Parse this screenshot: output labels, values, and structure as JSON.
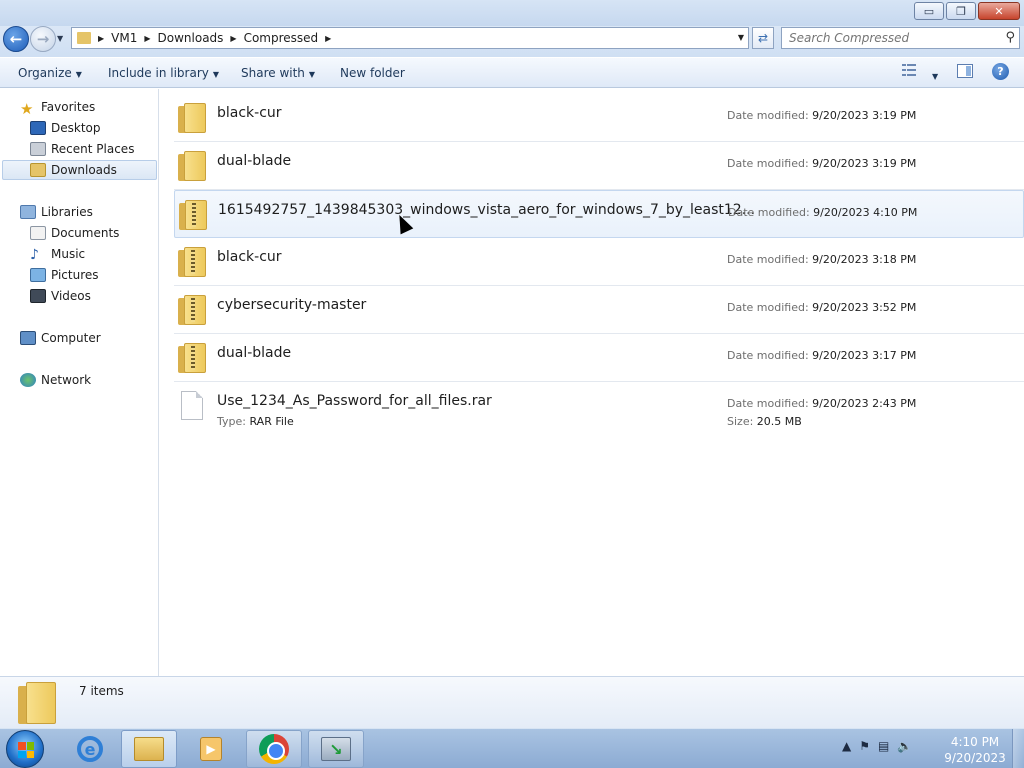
{
  "window": {
    "minimize_glyph": "▭",
    "restore_glyph": "❐",
    "close_glyph": "✕"
  },
  "address_bar": {
    "breadcrumbs": [
      "VM1",
      "Downloads",
      "Compressed"
    ],
    "search_placeholder": "Search Compressed"
  },
  "toolbar": {
    "organize": "Organize",
    "include_in_library": "Include in library",
    "share_with": "Share with",
    "new_folder": "New folder",
    "help": "?"
  },
  "sidebar": {
    "favorites": {
      "label": "Favorites",
      "items": [
        "Desktop",
        "Recent Places",
        "Downloads"
      ]
    },
    "libraries": {
      "label": "Libraries",
      "items": [
        "Documents",
        "Music",
        "Pictures",
        "Videos"
      ]
    },
    "computer": "Computer",
    "network": "Network"
  },
  "files": [
    {
      "name": "black-cur",
      "date_label": "Date modified:",
      "date": "9/20/2023 3:19 PM",
      "kind": "folder"
    },
    {
      "name": "dual-blade",
      "date_label": "Date modified:",
      "date": "9/20/2023 3:19 PM",
      "kind": "folder"
    },
    {
      "name": "1615492757_1439845303_windows_vista_aero_for_windows_7_by_least12...",
      "date_label": "Date modified:",
      "date": "9/20/2023 4:10 PM",
      "kind": "zip"
    },
    {
      "name": "black-cur",
      "date_label": "Date modified:",
      "date": "9/20/2023 3:18 PM",
      "kind": "zip"
    },
    {
      "name": "cybersecurity-master",
      "date_label": "Date modified:",
      "date": "9/20/2023 3:52 PM",
      "kind": "zip"
    },
    {
      "name": "dual-blade",
      "date_label": "Date modified:",
      "date": "9/20/2023 3:17 PM",
      "kind": "zip"
    },
    {
      "name": "Use_1234_As_Password_for_all_files.rar",
      "date_label": "Date modified:",
      "date": "9/20/2023 2:43 PM",
      "kind": "file",
      "type_label": "Type:",
      "type": "RAR File",
      "size_label": "Size:",
      "size": "20.5 MB"
    }
  ],
  "details": {
    "count": "7 items"
  },
  "taskbar": {
    "ie_glyph": "e",
    "time": "4:10 PM",
    "date": "9/20/2023"
  },
  "colors": {
    "accent": "#1e5db8",
    "hover_row": "#e9f1fb",
    "folder": "#edc95c"
  }
}
